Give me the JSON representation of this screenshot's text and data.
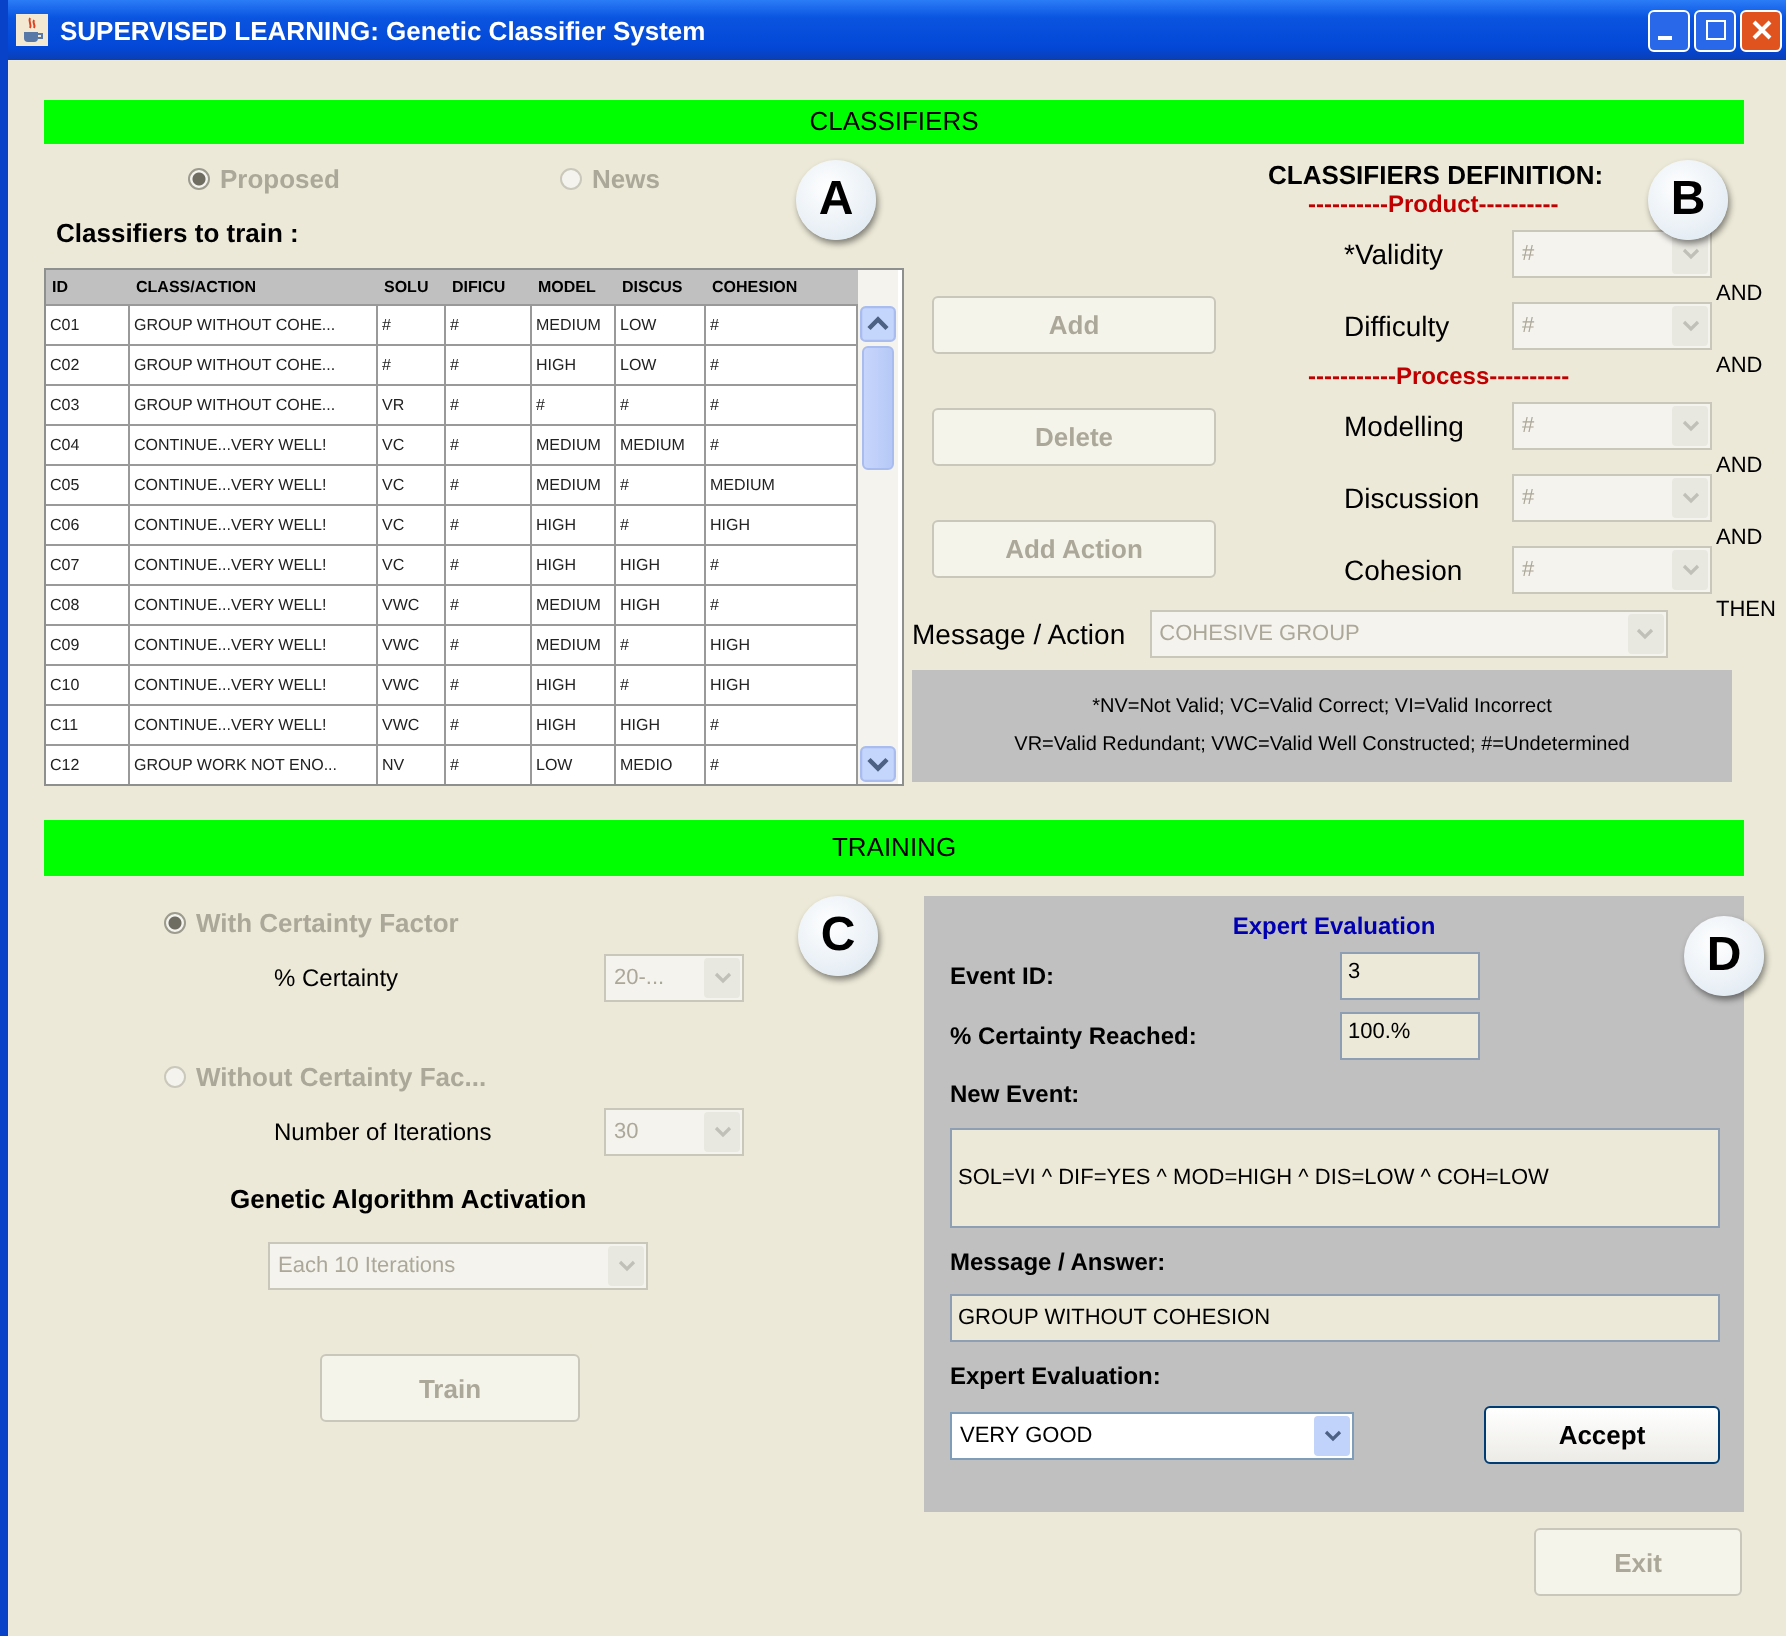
{
  "window": {
    "title": "SUPERVISED LEARNING: Genetic Classifier System"
  },
  "classifiers": {
    "header": "CLASSIFIERS",
    "callout_left": "A",
    "callout_right": "B",
    "radios": [
      {
        "label": "Proposed",
        "selected": true,
        "disabled": true
      },
      {
        "label": "News",
        "selected": false,
        "disabled": true
      }
    ],
    "list_title": "Classifiers to train :",
    "table": {
      "columns": [
        "ID",
        "CLASS/ACTION",
        "SOLU",
        "DIFICU",
        "MODEL",
        "DISCUS",
        "COHESION"
      ],
      "rows": [
        [
          "C01",
          "GROUP WITHOUT COHE...",
          "#",
          "#",
          "MEDIUM",
          "LOW",
          "#"
        ],
        [
          "C02",
          "GROUP WITHOUT COHE...",
          "#",
          "#",
          "HIGH",
          "LOW",
          "#"
        ],
        [
          "C03",
          "GROUP WITHOUT COHE...",
          "VR",
          "#",
          "#",
          "#",
          "#"
        ],
        [
          "C04",
          "CONTINUE...VERY WELL!",
          "VC",
          "#",
          "MEDIUM",
          "MEDIUM",
          "#"
        ],
        [
          "C05",
          "CONTINUE...VERY WELL!",
          "VC",
          "#",
          "MEDIUM",
          "#",
          "MEDIUM"
        ],
        [
          "C06",
          "CONTINUE...VERY WELL!",
          "VC",
          "#",
          "HIGH",
          "#",
          "HIGH"
        ],
        [
          "C07",
          "CONTINUE...VERY WELL!",
          "VC",
          "#",
          "HIGH",
          "HIGH",
          "#"
        ],
        [
          "C08",
          "CONTINUE...VERY WELL!",
          "VWC",
          "#",
          "MEDIUM",
          "HIGH",
          "#"
        ],
        [
          "C09",
          "CONTINUE...VERY WELL!",
          "VWC",
          "#",
          "MEDIUM",
          "#",
          "HIGH"
        ],
        [
          "C10",
          "CONTINUE...VERY WELL!",
          "VWC",
          "#",
          "HIGH",
          "#",
          "HIGH"
        ],
        [
          "C11",
          "CONTINUE...VERY WELL!",
          "VWC",
          "#",
          "HIGH",
          "HIGH",
          "#"
        ],
        [
          "C12",
          "GROUP WORK NOT ENO...",
          "NV",
          "#",
          "LOW",
          "MEDIO",
          "#"
        ]
      ]
    },
    "buttons": [
      {
        "label": "Add",
        "disabled": true
      },
      {
        "label": "Delete",
        "disabled": true
      },
      {
        "label": "Add Action",
        "disabled": true
      }
    ],
    "definition": {
      "title": "CLASSIFIERS DEFINITION:",
      "groups": [
        {
          "heading": "----------Product----------",
          "fields": [
            {
              "label": "*Validity",
              "value": "#",
              "disabled": true,
              "conjunction": "AND"
            },
            {
              "label": "Difficulty",
              "value": "#",
              "disabled": true,
              "conjunction": "AND"
            }
          ]
        },
        {
          "heading": "-----------Process----------",
          "fields": [
            {
              "label": "Modelling",
              "value": "#",
              "disabled": true,
              "conjunction": "AND"
            },
            {
              "label": "Discussion",
              "value": "#",
              "disabled": true,
              "conjunction": "AND"
            },
            {
              "label": "Cohesion",
              "value": "#",
              "disabled": true,
              "conjunction": "THEN"
            }
          ]
        }
      ]
    },
    "message": {
      "label": "Message / Action",
      "value": "COHESIVE GROUP",
      "disabled": true
    },
    "legend": [
      "*NV=Not Valid; VC=Valid Correct; VI=Valid Incorrect",
      "VR=Valid Redundant; VWC=Valid Well Constructed; #=Undetermined"
    ]
  },
  "training": {
    "header": "TRAINING",
    "callout_left": "C",
    "callout_right": "D",
    "options": [
      {
        "label": "With Certainty Factor",
        "selected": true,
        "disabled": true,
        "setting": {
          "label": "% Certainty",
          "value": "20-...",
          "disabled": true
        }
      },
      {
        "label": "Without Certainty Fac...",
        "selected": false,
        "disabled": true,
        "setting": {
          "label": "Number of Iterations",
          "value": "30",
          "disabled": true
        }
      }
    ],
    "ga_title": "Genetic Algorithm Activation",
    "ga_select": {
      "value": "Each 10 Iterations",
      "disabled": true
    },
    "train_button": {
      "label": "Train",
      "disabled": true
    },
    "expert": {
      "title": "Expert Evaluation",
      "event_id": {
        "label": "Event ID:",
        "value": "3"
      },
      "certainty": {
        "label": "% Certainty Reached:",
        "value": "100.%"
      },
      "new_event": {
        "label": "New Event:",
        "value": "SOL=VI ^ DIF=YES ^ MOD=HIGH ^ DIS=LOW ^ COH=LOW"
      },
      "answer": {
        "label": "Message / Answer:",
        "value": "GROUP WITHOUT COHESION"
      },
      "evaluation": {
        "label": "Expert Evaluation:",
        "value": "VERY GOOD",
        "disabled": false
      },
      "accept_button": {
        "label": "Accept",
        "disabled": false
      }
    },
    "exit_button": {
      "label": "Exit",
      "disabled": true
    }
  }
}
